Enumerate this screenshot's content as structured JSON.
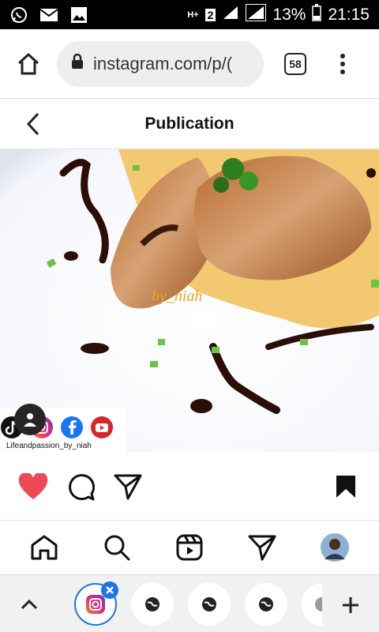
{
  "status_bar": {
    "network_type": "H+",
    "sim_slot": "2",
    "battery": "13%",
    "time": "21:15"
  },
  "browser": {
    "url": "instagram.com/p/(",
    "tab_count": "58"
  },
  "post_header": {
    "title": "Publication"
  },
  "post_image": {
    "watermark": "by_niah",
    "social_caption": "Lifeandpassion_by_niah"
  },
  "colors": {
    "like_red": "#ED4956",
    "accent_blue": "#1a73e8",
    "instagram_gradient_start": "#F58529",
    "instagram_gradient_end": "#8134AF"
  }
}
